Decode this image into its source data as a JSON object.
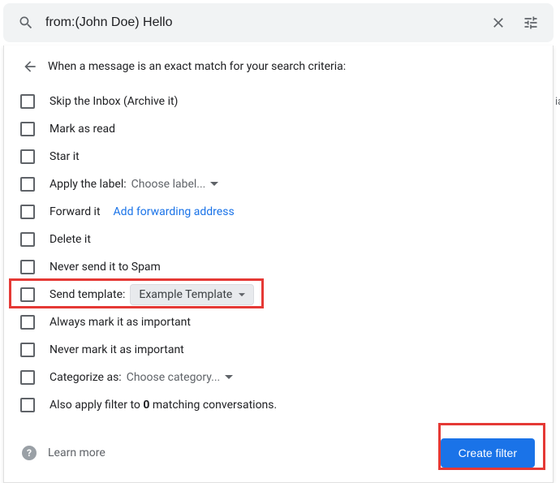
{
  "search": {
    "value": "from:(John Doe) Hello"
  },
  "header": "When a message is an exact match for your search criteria:",
  "options": {
    "skip_inbox": "Skip the Inbox (Archive it)",
    "mark_read": "Mark as read",
    "star": "Star it",
    "apply_label_prefix": "Apply the label:",
    "apply_label_value": "Choose label...",
    "forward": "Forward it",
    "forward_link": "Add forwarding address",
    "delete": "Delete it",
    "never_spam": "Never send it to Spam",
    "send_template_prefix": "Send template:",
    "send_template_value": "Example Template",
    "always_important": "Always mark it as important",
    "never_important": "Never mark it as important",
    "categorize_prefix": "Categorize as:",
    "categorize_value": "Choose category...",
    "also_apply_prefix": "Also apply filter to ",
    "also_apply_count": "0",
    "also_apply_suffix": " matching conversations."
  },
  "footer": {
    "learn_more": "Learn more",
    "create_filter": "Create filter"
  },
  "edge_char": "ia"
}
